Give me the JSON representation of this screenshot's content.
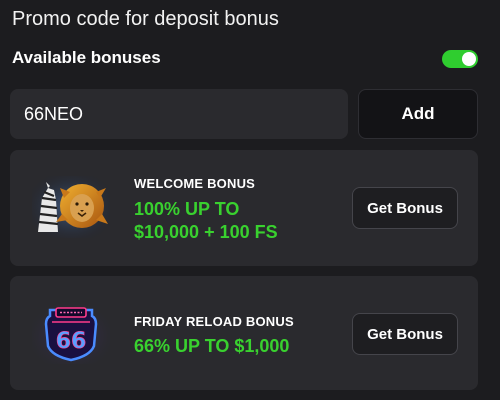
{
  "header": {
    "title": "Promo code for deposit bonus"
  },
  "available_bonuses": {
    "label": "Available bonuses",
    "toggle_on": true,
    "toggle_color": "#2fcd2f"
  },
  "promo": {
    "value": "66NEO",
    "add_label": "Add"
  },
  "bonuses": [
    {
      "name": "WELCOME BONUS",
      "offer": "100% UP TO\n$10,000 + 100 FS",
      "button_label": "Get Bonus",
      "image_icon": "zebra-lion-icon"
    },
    {
      "name": "FRIDAY RELOAD BONUS",
      "offer": "66% UP TO $1,000",
      "button_label": "Get Bonus",
      "image_icon": "route-66-icon"
    }
  ],
  "colors": {
    "background": "#1c1c1f",
    "card": "#2a2a2e",
    "accent_green": "#39d12f"
  }
}
